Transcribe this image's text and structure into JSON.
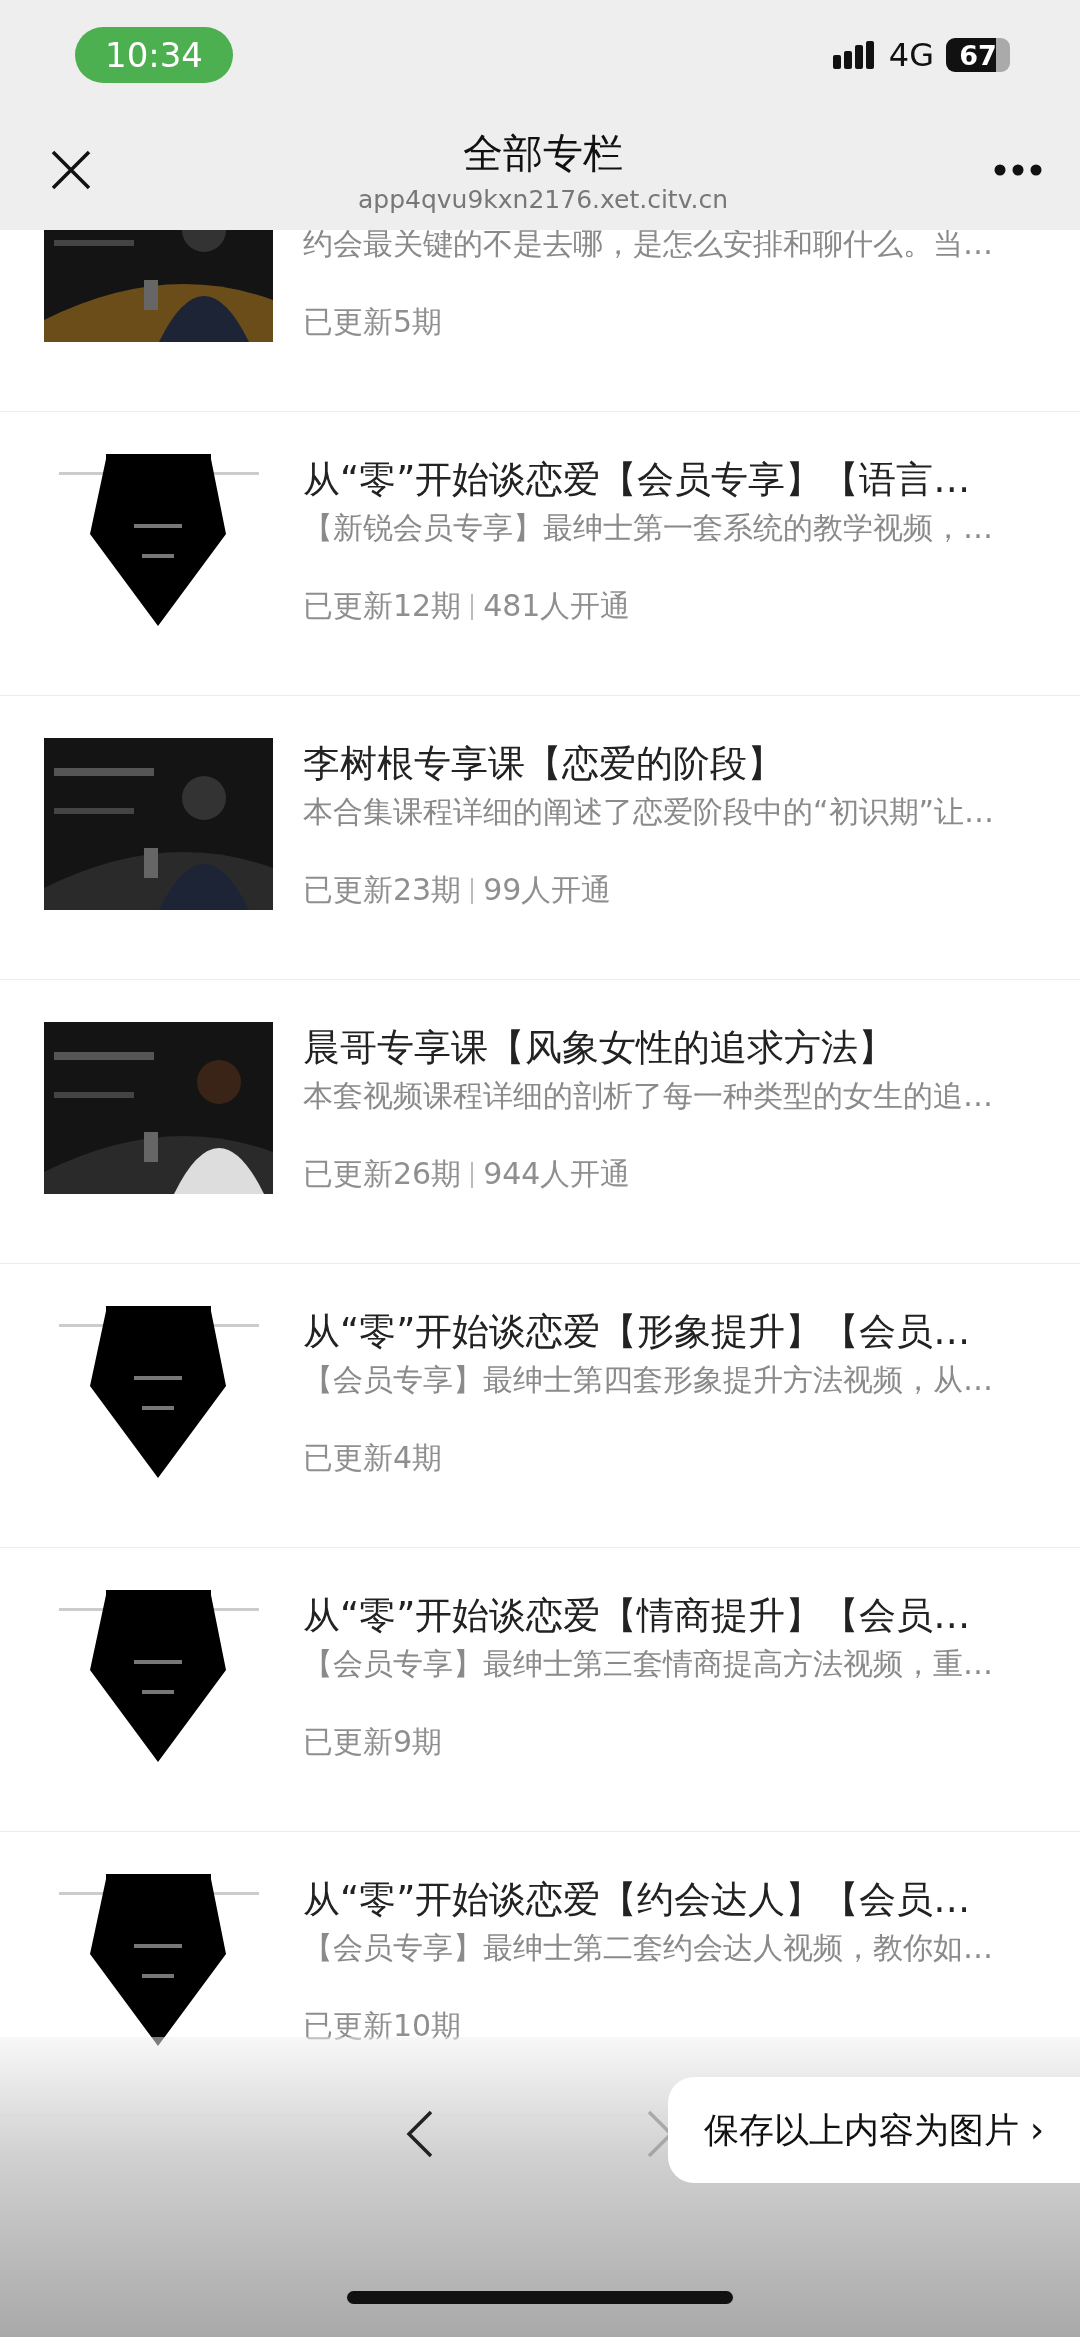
{
  "status_bar": {
    "time": "10:34",
    "network": "4G",
    "battery": "67"
  },
  "header": {
    "title": "全部专栏",
    "url": "app4qvu9kxn2176.xet.citv.cn"
  },
  "columns": [
    {
      "description": "约会最关键的不是去哪，是怎么安排和聊什么。当…",
      "updates": "已更新5期"
    },
    {
      "title": "从“零”开始谈恋爱【会员专享】【语言…",
      "description": "【新锐会员专享】最绅士第一套系统的教学视频，…",
      "updates": "已更新12期",
      "subscribers": "481人开通"
    },
    {
      "title": "李树根专享课【恋爱的阶段】",
      "description": "本合集课程详细的阐述了恋爱阶段中的“初识期”让…",
      "updates": "已更新23期",
      "subscribers": "99人开通"
    },
    {
      "title": "晨哥专享课【风象女性的追求方法】",
      "description": "本套视频课程详细的剖析了每一种类型的女生的追…",
      "updates": "已更新26期",
      "subscribers": "944人开通"
    },
    {
      "title": "从“零”开始谈恋爱【形象提升】【会员…",
      "description": "【会员专享】最绅士第四套形象提升方法视频，从…",
      "updates": "已更新4期"
    },
    {
      "title": "从“零”开始谈恋爱【情商提升】【会员…",
      "description": "【会员专享】最绅士第三套情商提高方法视频，重…",
      "updates": "已更新9期"
    },
    {
      "title": "从“零”开始谈恋爱【约会达人】【会员…",
      "description": "【会员专享】最绅士第二套约会达人视频，教你如…",
      "updates": "已更新10期"
    }
  ],
  "toolbar": {
    "back": {
      "disabled": false
    },
    "forward": {
      "disabled": true
    }
  },
  "save_popup": {
    "label": "保存以上内容为图片",
    "chevron": "›"
  }
}
